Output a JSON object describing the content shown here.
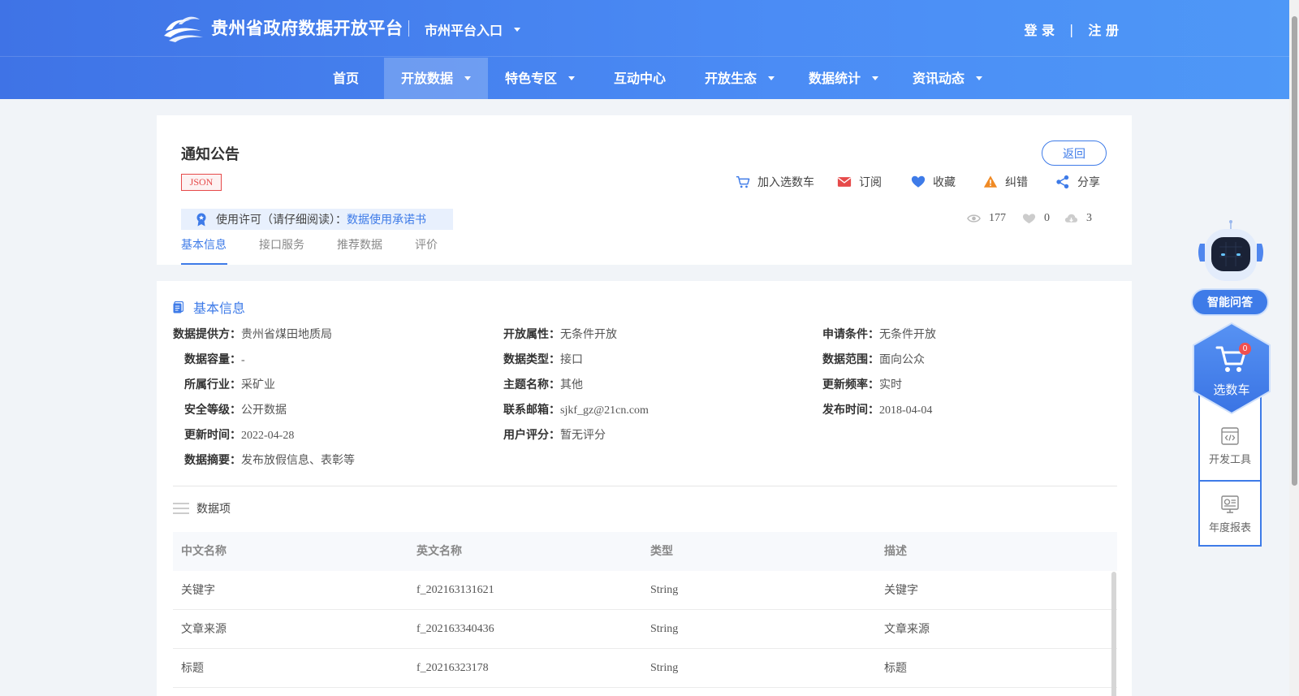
{
  "header": {
    "site_title": "贵州省政府数据开放平台",
    "city_entry": "市州平台入口",
    "login": "登 录",
    "separator": "|",
    "register": "注 册"
  },
  "nav": {
    "items": [
      {
        "label": "首页",
        "has_dropdown": false
      },
      {
        "label": "开放数据",
        "has_dropdown": true,
        "active": true
      },
      {
        "label": "特色专区",
        "has_dropdown": true
      },
      {
        "label": "互动中心",
        "has_dropdown": false
      },
      {
        "label": "开放生态",
        "has_dropdown": true
      },
      {
        "label": "数据统计",
        "has_dropdown": true
      },
      {
        "label": "资讯动态",
        "has_dropdown": true
      }
    ]
  },
  "dataset": {
    "title": "通知公告",
    "back_label": "返回",
    "format_tag": "JSON",
    "actions": {
      "cart": "加入选数车",
      "subscribe": "订阅",
      "favorite": "收藏",
      "correct": "纠错",
      "share": "分享"
    },
    "license": {
      "prefix": "使用许可（请仔细阅读）：",
      "link": "数据使用承诺书"
    },
    "stats": {
      "views": "177",
      "likes": "0",
      "downloads": "3"
    },
    "tabs": [
      "基本信息",
      "接口服务",
      "推荐数据",
      "评价"
    ]
  },
  "basic_info": {
    "section_title": "基本信息",
    "col1": [
      {
        "k": "数据提供方：",
        "v": "贵州省煤田地质局"
      },
      {
        "k": "数据容量：",
        "v": "-"
      },
      {
        "k": "所属行业：",
        "v": "采矿业"
      },
      {
        "k": "安全等级：",
        "v": "公开数据"
      },
      {
        "k": "更新时间：",
        "v": "2022-04-28"
      },
      {
        "k": "数据摘要：",
        "v": "发布放假信息、表彰等"
      }
    ],
    "col2": [
      {
        "k": "开放属性：",
        "v": "无条件开放"
      },
      {
        "k": "数据类型：",
        "v": "接口"
      },
      {
        "k": "主题名称：",
        "v": "其他"
      },
      {
        "k": "联系邮箱：",
        "v": "sjkf_gz@21cn.com"
      },
      {
        "k": "用户评分：",
        "v": "暂无评分"
      }
    ],
    "col3": [
      {
        "k": "申请条件：",
        "v": "无条件开放"
      },
      {
        "k": "数据范围：",
        "v": "面向公众"
      },
      {
        "k": "更新频率：",
        "v": "实时"
      },
      {
        "k": "发布时间：",
        "v": "2018-04-04"
      }
    ]
  },
  "data_items": {
    "title": "数据项",
    "columns": [
      "中文名称",
      "英文名称",
      "类型",
      "描述"
    ],
    "rows": [
      [
        "关键字",
        "f_202163131621",
        "String",
        "关键字"
      ],
      [
        "文章来源",
        "f_202163340436",
        "String",
        "文章来源"
      ],
      [
        "标题",
        "f_20216323178",
        "String",
        "标题"
      ]
    ]
  },
  "sidebar": {
    "ai_label": "智能问答",
    "cart_label": "选数车",
    "cart_count": "0",
    "dev_tools": "开发工具",
    "annual_report": "年度报表"
  },
  "colors": {
    "primary": "#3e7be8",
    "header_start": "#3f73e6",
    "header_end": "#4e98f7",
    "danger": "#e64a4a",
    "warning": "#f08a24"
  }
}
